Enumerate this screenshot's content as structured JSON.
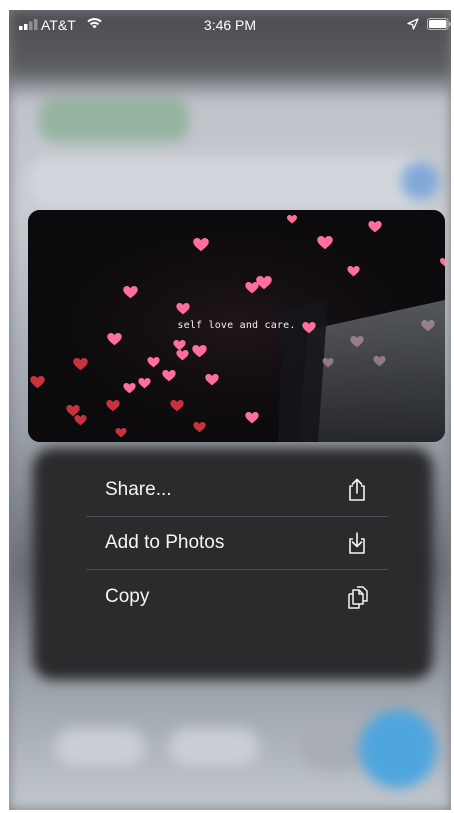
{
  "status_bar": {
    "carrier": "AT&T",
    "time": "3:46 PM",
    "icons": [
      "signal-bars-icon",
      "wifi-icon",
      "location-arrow-icon",
      "battery-icon"
    ]
  },
  "preview": {
    "caption": "self love and care."
  },
  "context_menu": {
    "items": [
      {
        "label": "Share...",
        "icon": "share-icon"
      },
      {
        "label": "Add to Photos",
        "icon": "save-to-photos-icon"
      },
      {
        "label": "Copy",
        "icon": "copy-icon"
      }
    ]
  },
  "colors": {
    "menu_background": "#2c2c2e",
    "menu_text": "#f5f5f7",
    "heart_pink": "#ff6f9c",
    "heart_red": "#c8323c",
    "accent_blue": "#4fa6de"
  }
}
